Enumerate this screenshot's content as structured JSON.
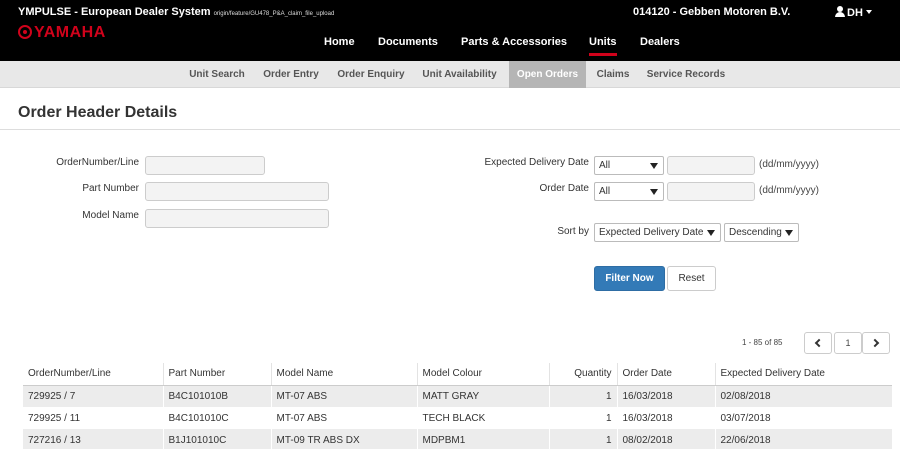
{
  "header": {
    "system_title": "YMPULSE - European Dealer System",
    "branch": "origin/feature/GU478_P&A_claim_file_upload",
    "logo_text": "YAMAHA",
    "dealer": "014120 - Gebben Motoren B.V.",
    "user_initials": "DH",
    "nav": [
      "Home",
      "Documents",
      "Parts & Accessories",
      "Units",
      "Dealers"
    ],
    "active_nav": "Units"
  },
  "subnav": {
    "items": [
      "Unit Search",
      "Order Entry",
      "Order Enquiry",
      "Unit Availability",
      "Open Orders",
      "Claims",
      "Service Records"
    ],
    "active": "Open Orders"
  },
  "page_title": "Order Header Details",
  "filters": {
    "order_number_label": "OrderNumber/Line",
    "part_number_label": "Part Number",
    "model_name_label": "Model Name",
    "order_number_value": "",
    "part_number_value": "",
    "model_name_value": "",
    "expected_delivery_label": "Expected Delivery Date",
    "expected_delivery_option": "All",
    "expected_delivery_value": "",
    "order_date_label": "Order Date",
    "order_date_option": "All",
    "order_date_value": "",
    "date_format_hint": "(dd/mm/yyyy)",
    "sort_by_label": "Sort by",
    "sort_field": "Expected Delivery Date",
    "sort_direction": "Descending",
    "filter_button": "Filter Now",
    "reset_button": "Reset"
  },
  "pagination": {
    "summary": "1 - 85 of 85",
    "current_page": "1"
  },
  "table": {
    "columns": [
      "OrderNumber/Line",
      "Part Number",
      "Model Name",
      "Model Colour",
      "Quantity",
      "Order Date",
      "Expected Delivery Date"
    ],
    "rows": [
      [
        "729925 / 7",
        "B4C101010B",
        "MT-07 ABS",
        "MATT GRAY",
        "1",
        "16/03/2018",
        "02/08/2018"
      ],
      [
        "729925 / 11",
        "B4C101010C",
        "MT-07 ABS",
        "TECH BLACK",
        "1",
        "16/03/2018",
        "03/07/2018"
      ],
      [
        "727216 / 13",
        "B1J101010C",
        "MT-09 TR ABS DX",
        "MDPBM1",
        "1",
        "08/02/2018",
        "22/06/2018"
      ]
    ]
  }
}
